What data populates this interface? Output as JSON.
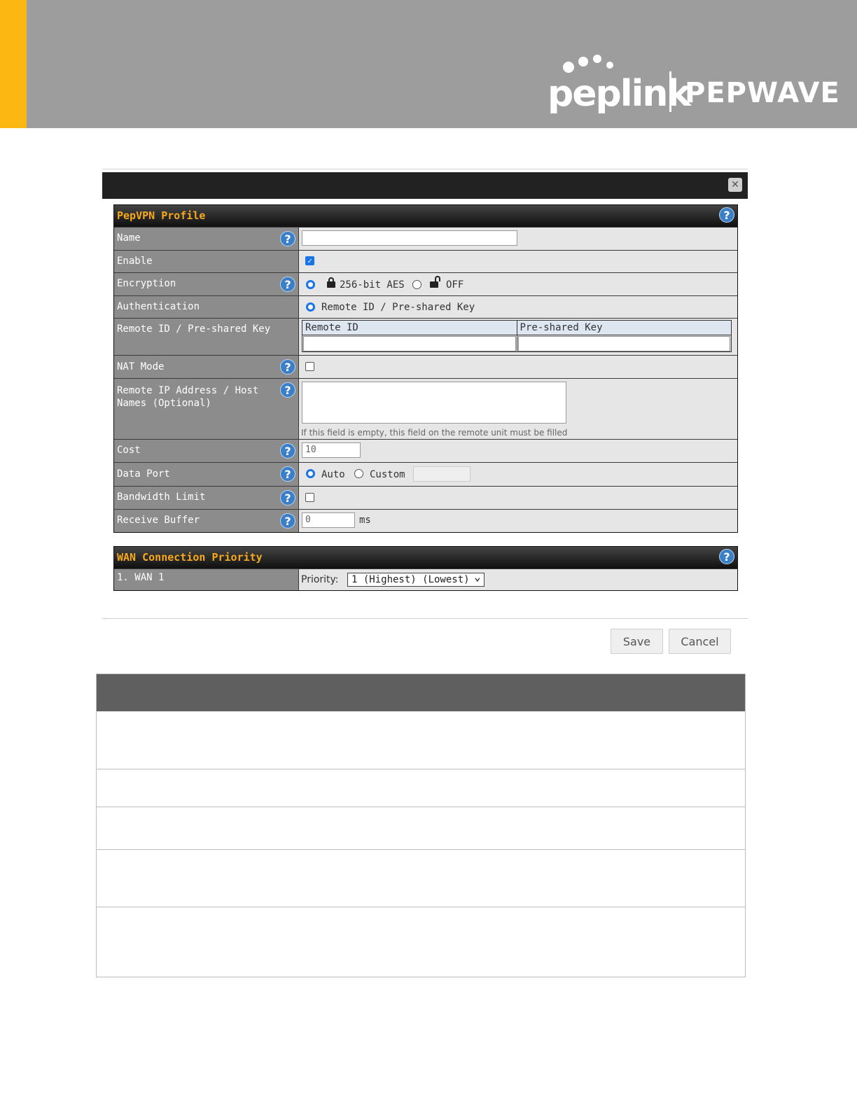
{
  "brand": {
    "left_logo": "peplink",
    "right_logo": "PEPWAVE",
    "accent_color": "#fdb713",
    "header_color": "#9d9d9d"
  },
  "dialog": {
    "close_icon": "close-icon"
  },
  "profile": {
    "title": "PepVPN Profile",
    "rows": {
      "name": {
        "label": "Name",
        "value": ""
      },
      "enable": {
        "label": "Enable",
        "checked": true
      },
      "encryption": {
        "label": "Encryption",
        "option1": "256-bit AES",
        "option2": "OFF",
        "selected": "256-bit AES"
      },
      "authentication": {
        "label": "Authentication",
        "option1": "Remote ID / Pre-shared Key"
      },
      "remote_id_psk": {
        "label": "Remote ID / Pre-shared Key",
        "col1": "Remote ID",
        "col2": "Pre-shared Key"
      },
      "nat_mode": {
        "label": "NAT Mode",
        "checked": false
      },
      "remote_ip": {
        "label": "Remote IP Address / Host Names (Optional)",
        "hint": "If this field is empty, this field on the remote unit must be filled"
      },
      "cost": {
        "label": "Cost",
        "value": "10"
      },
      "data_port": {
        "label": "Data Port",
        "option1": "Auto",
        "option2": "Custom",
        "selected": "Auto"
      },
      "bandwidth_limit": {
        "label": "Bandwidth Limit",
        "checked": false
      },
      "receive_buffer": {
        "label": "Receive Buffer",
        "value": "0",
        "unit": "ms"
      }
    }
  },
  "wan": {
    "title": "WAN Connection Priority",
    "row_label": "1. WAN 1",
    "priority_label": "Priority:",
    "priority_value": "1 (Highest) (Lowest)"
  },
  "buttons": {
    "save": "Save",
    "cancel": "Cancel"
  }
}
